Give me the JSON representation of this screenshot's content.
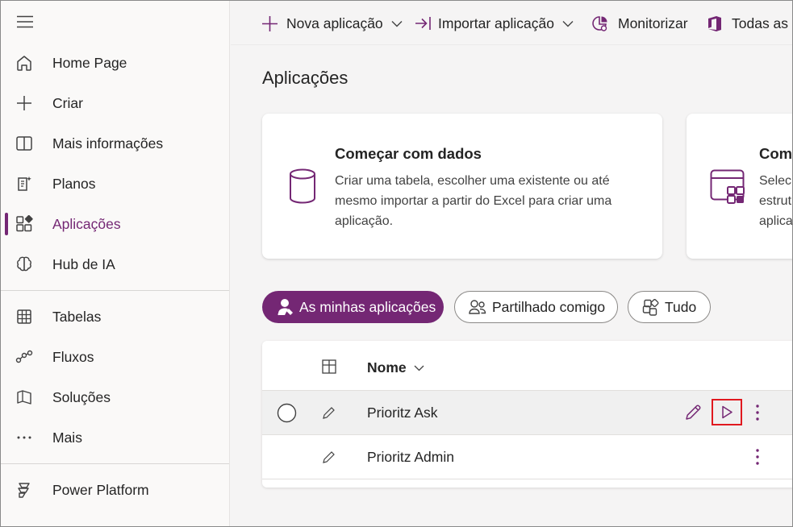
{
  "sidebar": {
    "items": [
      {
        "label": "Home Page",
        "icon": "home-icon"
      },
      {
        "label": "Criar",
        "icon": "plus-icon"
      },
      {
        "label": "Mais informações",
        "icon": "book-icon"
      },
      {
        "label": "Planos",
        "icon": "plans-icon"
      },
      {
        "label": "Aplicações",
        "icon": "apps-icon",
        "active": true
      },
      {
        "label": "Hub de IA",
        "icon": "brain-icon"
      },
      {
        "label": "Tabelas",
        "icon": "table-icon"
      },
      {
        "label": "Fluxos",
        "icon": "flow-icon"
      },
      {
        "label": "Soluções",
        "icon": "solutions-icon"
      },
      {
        "label": "Mais",
        "icon": "more-icon"
      },
      {
        "label": "Power Platform",
        "icon": "power-platform-icon"
      }
    ]
  },
  "toolbar": {
    "new_app": "Nova aplicação",
    "import_app": "Importar aplicação",
    "monitor": "Monitorizar",
    "all": "Todas as a"
  },
  "main": {
    "title": "Aplicações",
    "cards": [
      {
        "title": "Começar com dados",
        "desc_lines": [
          "Criar uma tabela, escolher uma existente ou até",
          "mesmo importar a partir do Excel para criar uma",
          "aplicação."
        ]
      },
      {
        "title": "Com",
        "desc_lines": [
          "Selec",
          "estrut",
          "aplica"
        ]
      }
    ],
    "filters": {
      "mine": "As minhas aplicações",
      "shared": "Partilhado comigo",
      "all": "Tudo"
    },
    "table": {
      "name_header": "Nome",
      "rows": [
        {
          "name": "Prioritz Ask"
        },
        {
          "name": "Prioritz Admin"
        }
      ]
    }
  },
  "colors": {
    "accent": "#742774",
    "highlight_border": "#e0191f"
  }
}
